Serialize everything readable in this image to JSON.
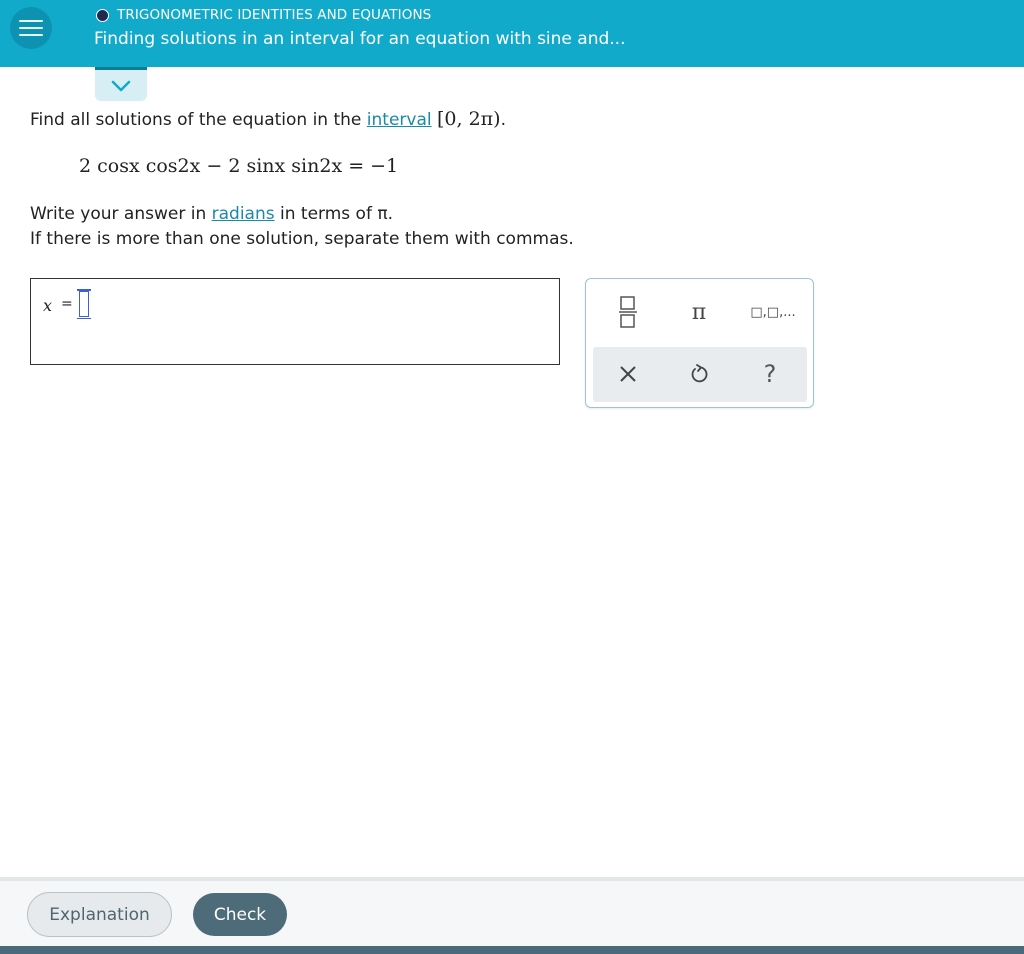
{
  "header": {
    "topic": "TRIGONOMETRIC IDENTITIES AND EQUATIONS",
    "title": "Finding solutions in an interval for an equation with sine and...",
    "menu_icon": "hamburger-menu-icon",
    "collapse_icon": "chevron-down-icon"
  },
  "question": {
    "prompt": "Find all solutions of the equation in the",
    "interval_link": "interval",
    "interval_math": "[0, 2π)",
    "period": ".",
    "equation": "2 cosx cos2x − 2 sinx sin2x = −1",
    "instruction1_before": "Write your answer in",
    "instruction1_link": "radians",
    "instruction1_after": "in terms of π.",
    "instruction2": "If there is more than one solution, separate them with commas."
  },
  "answer": {
    "label": "x",
    "equals": "=",
    "value": ""
  },
  "tools": {
    "fraction_icon": "fraction-icon",
    "pi_symbol": "π",
    "list_symbol": "□,□,...",
    "clear_icon": "clear-x-icon",
    "undo_icon": "undo-icon",
    "help_symbol": "?"
  },
  "footer": {
    "explanation_label": "Explanation",
    "check_label": "Check"
  },
  "colors": {
    "header_bg": "#12aacb",
    "link": "#1a8aa8",
    "check_button": "#4d6b79",
    "input_cursor": "#3f5fd2"
  }
}
